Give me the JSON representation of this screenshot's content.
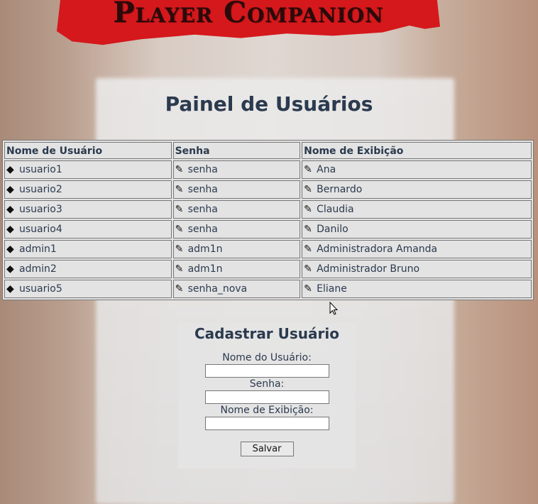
{
  "banner": {
    "title": "Player Companion"
  },
  "page": {
    "title": "Painel de Usuários"
  },
  "table": {
    "headers": [
      "Nome de Usuário",
      "Senha",
      "Nome de Exibição"
    ],
    "rows": [
      {
        "username": "usuario1",
        "password": "senha",
        "display": "Ana"
      },
      {
        "username": "usuario2",
        "password": "senha",
        "display": "Bernardo"
      },
      {
        "username": "usuario3",
        "password": "senha",
        "display": "Claudia"
      },
      {
        "username": "usuario4",
        "password": "senha",
        "display": "Danilo"
      },
      {
        "username": "admin1",
        "password": "adm1n",
        "display": "Administradora Amanda"
      },
      {
        "username": "admin2",
        "password": "adm1n",
        "display": "Administrador Bruno"
      },
      {
        "username": "usuario5",
        "password": "senha_nova",
        "display": "Eliane"
      }
    ],
    "icons": {
      "delete": "eraser-icon",
      "edit": "pencil-icon"
    }
  },
  "form": {
    "title": "Cadastrar Usuário",
    "username_label": "Nome do Usuário:",
    "password_label": "Senha:",
    "display_label": "Nome de Exibição:",
    "username_value": "",
    "password_value": "",
    "display_value": "",
    "save_label": "Salvar"
  },
  "colors": {
    "banner": "#d4181c",
    "heading": "#2b3a4e"
  }
}
